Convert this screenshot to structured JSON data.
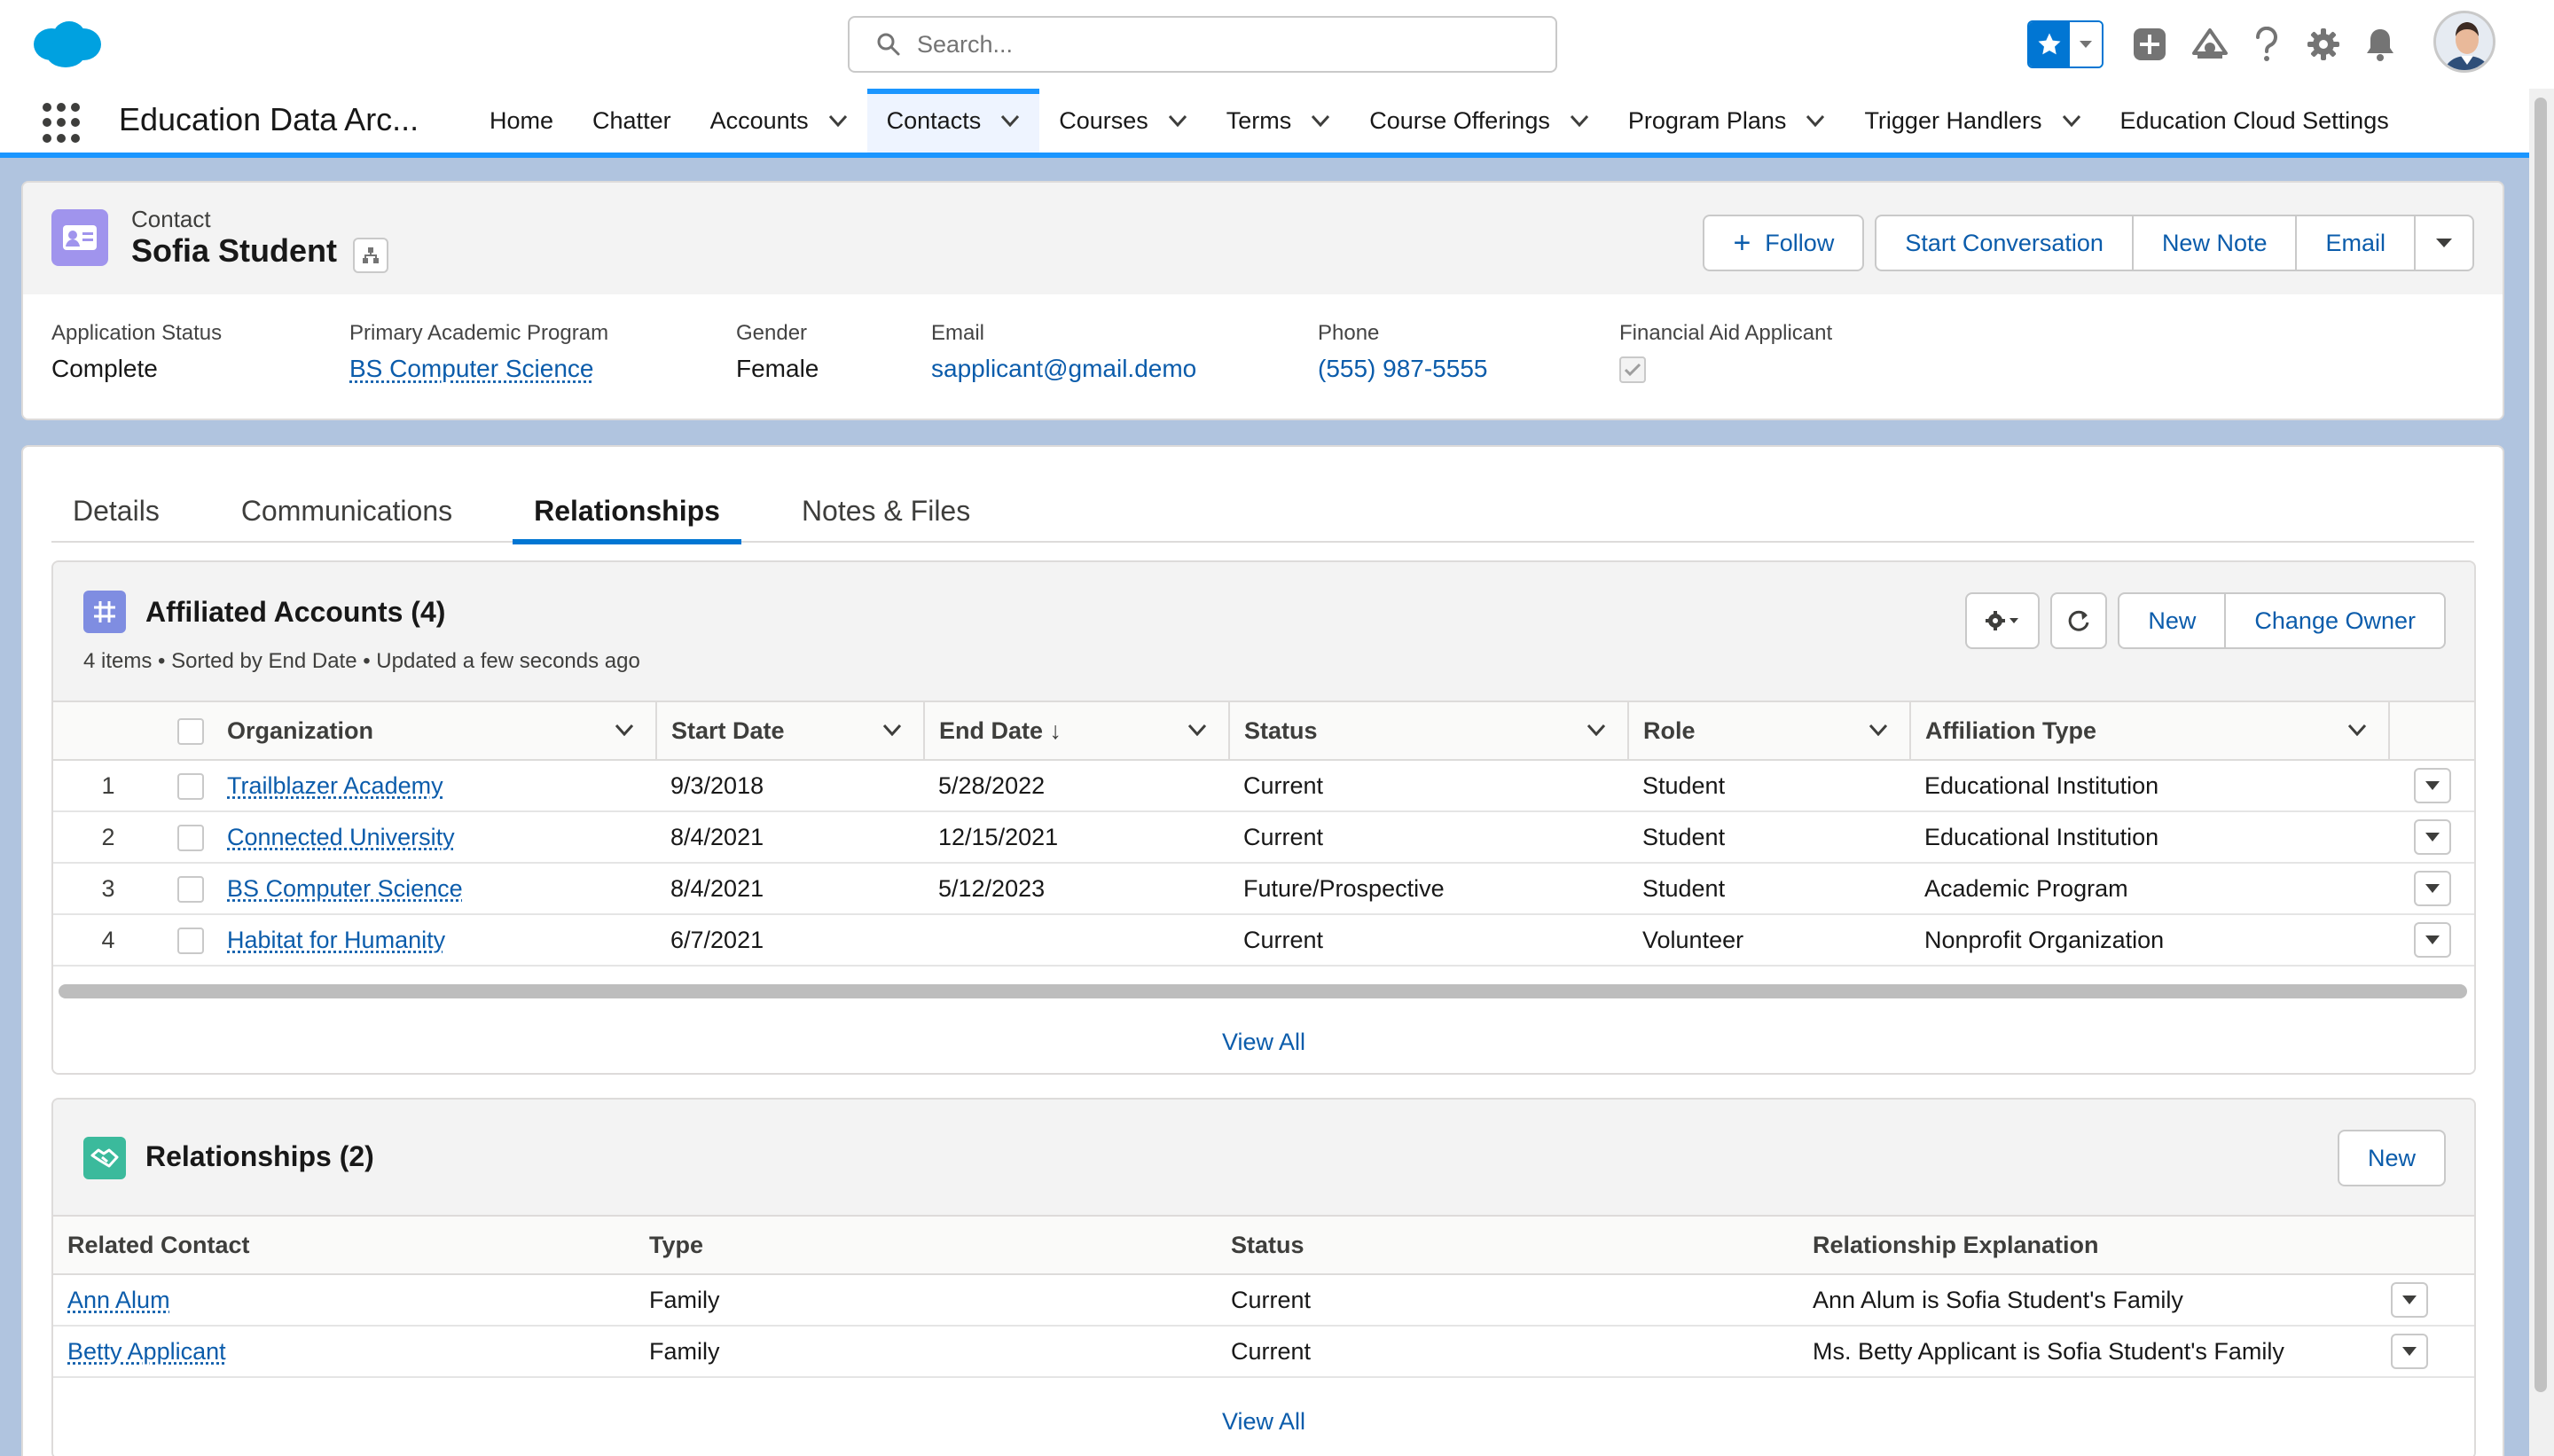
{
  "global_header": {
    "search_placeholder": "Search...",
    "icons": [
      "salesforce-cloud-logo",
      "star-icon",
      "chevron-down-icon",
      "add-icon",
      "trailhead-icon",
      "help-icon",
      "gear-icon",
      "bell-icon",
      "avatar"
    ]
  },
  "app_nav": {
    "app_name": "Education Data Arc...",
    "items": [
      {
        "label": "Home",
        "dropdown": false
      },
      {
        "label": "Chatter",
        "dropdown": false
      },
      {
        "label": "Accounts",
        "dropdown": true
      },
      {
        "label": "Contacts",
        "dropdown": true,
        "active": true
      },
      {
        "label": "Courses",
        "dropdown": true
      },
      {
        "label": "Terms",
        "dropdown": true
      },
      {
        "label": "Course Offerings",
        "dropdown": true
      },
      {
        "label": "Program Plans",
        "dropdown": true
      },
      {
        "label": "Trigger Handlers",
        "dropdown": true
      },
      {
        "label": "Education Cloud Settings",
        "dropdown": false
      }
    ]
  },
  "record": {
    "object_type": "Contact",
    "name": "Sofia Student",
    "actions": {
      "follow": "Follow",
      "start_conversation": "Start Conversation",
      "new_note": "New Note",
      "email": "Email"
    },
    "fields": [
      {
        "label": "Application Status",
        "value": "Complete"
      },
      {
        "label": "Primary Academic Program",
        "value": "BS Computer Science"
      },
      {
        "label": "Gender",
        "value": "Female"
      },
      {
        "label": "Email",
        "value": "sapplicant@gmail.demo"
      },
      {
        "label": "Phone",
        "value": "(555) 987-5555"
      },
      {
        "label": "Financial Aid Applicant",
        "value": true
      }
    ]
  },
  "tabs": [
    {
      "label": "Details"
    },
    {
      "label": "Communications"
    },
    {
      "label": "Relationships",
      "active": true
    },
    {
      "label": "Notes & Files"
    }
  ],
  "affiliated_accounts": {
    "title": "Affiliated Accounts (4)",
    "subtitle": "4 items • Sorted by End Date • Updated a few seconds ago",
    "buttons": {
      "new": "New",
      "change_owner": "Change Owner"
    },
    "columns": [
      "Organization",
      "Start Date",
      "End Date",
      "Status",
      "Role",
      "Affiliation Type"
    ],
    "sort_indicator": "↓",
    "rows": [
      {
        "num": "1",
        "organization": "Trailblazer Academy",
        "start": "9/3/2018",
        "end": "5/28/2022",
        "status": "Current",
        "role": "Student",
        "type": "Educational Institution"
      },
      {
        "num": "2",
        "organization": "Connected University",
        "start": "8/4/2021",
        "end": "12/15/2021",
        "status": "Current",
        "role": "Student",
        "type": "Educational Institution"
      },
      {
        "num": "3",
        "organization": "BS Computer Science",
        "start": "8/4/2021",
        "end": "5/12/2023",
        "status": "Future/Prospective",
        "role": "Student",
        "type": "Academic Program"
      },
      {
        "num": "4",
        "organization": "Habitat for Humanity",
        "start": "6/7/2021",
        "end": "",
        "status": "Current",
        "role": "Volunteer",
        "type": "Nonprofit Organization"
      }
    ],
    "view_all": "View All"
  },
  "relationships": {
    "title": "Relationships (2)",
    "buttons": {
      "new": "New"
    },
    "columns": [
      "Related Contact",
      "Type",
      "Status",
      "Relationship Explanation"
    ],
    "rows": [
      {
        "contact": "Ann Alum",
        "type": "Family",
        "status": "Current",
        "explanation": "Ann Alum is Sofia Student's Family"
      },
      {
        "contact": "Betty Applicant",
        "type": "Family",
        "status": "Current",
        "explanation": "Ms. Betty Applicant is Sofia Student's Family"
      }
    ],
    "view_all": "View All"
  },
  "colors": {
    "brand_blue": "#0176d3",
    "link_blue": "#0b5cab",
    "contact_icon": "#a094ed",
    "affiliation_icon": "#7f8de1",
    "relationship_icon": "#3bba9c"
  }
}
